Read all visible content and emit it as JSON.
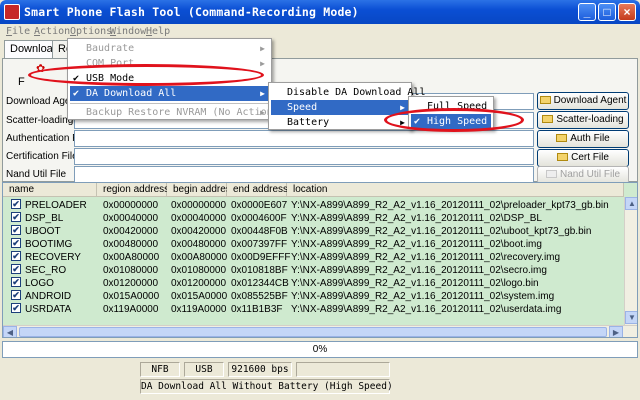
{
  "window": {
    "title": "Smart Phone Flash Tool (Command-Recording Mode)"
  },
  "window_buttons": {
    "minimize": "_",
    "maximize": "□",
    "close": "×"
  },
  "menubar": [
    {
      "key": "F",
      "rest": "ile"
    },
    {
      "key": "A",
      "rest": "ction"
    },
    {
      "key": "O",
      "rest": "ptions"
    },
    {
      "key": "W",
      "rest": "indow"
    },
    {
      "key": "H",
      "rest": "elp"
    }
  ],
  "tabs": {
    "download": "Download",
    "readback": "Re"
  },
  "toolbar": {
    "flash_label": "F"
  },
  "rows": [
    {
      "label": "Download Agent",
      "button": "Download Agent"
    },
    {
      "label": "Scatter-loading F",
      "button": "Scatter-loading"
    },
    {
      "label": "Authentication File",
      "button": "Auth File"
    },
    {
      "label": "Certification File",
      "button": "Cert File"
    },
    {
      "label": "Nand Util File",
      "button": "Nand Util File"
    }
  ],
  "table": {
    "headers": [
      "name",
      "region address",
      "begin address",
      "end address",
      "location"
    ],
    "rows": [
      {
        "checked": "✔",
        "name": "PRELOADER",
        "region": "0x00000000",
        "begin": "0x00000000",
        "end": "0x0000E607",
        "location": "Y:\\NX-A899\\A899_R2_A2_v1.16_20120111_02\\preloader_kpt73_gb.bin"
      },
      {
        "checked": "✔",
        "name": "DSP_BL",
        "region": "0x00040000",
        "begin": "0x00040000",
        "end": "0x0004600F",
        "location": "Y:\\NX-A899\\A899_R2_A2_v1.16_20120111_02\\DSP_BL"
      },
      {
        "checked": "✔",
        "name": "UBOOT",
        "region": "0x00420000",
        "begin": "0x00420000",
        "end": "0x00448F0B",
        "location": "Y:\\NX-A899\\A899_R2_A2_v1.16_20120111_02\\uboot_kpt73_gb.bin"
      },
      {
        "checked": "✔",
        "name": "BOOTIMG",
        "region": "0x00480000",
        "begin": "0x00480000",
        "end": "0x007397FF",
        "location": "Y:\\NX-A899\\A899_R2_A2_v1.16_20120111_02\\boot.img"
      },
      {
        "checked": "✔",
        "name": "RECOVERY",
        "region": "0x00A80000",
        "begin": "0x00A80000",
        "end": "0x00D9EFFF",
        "location": "Y:\\NX-A899\\A899_R2_A2_v1.16_20120111_02\\recovery.img"
      },
      {
        "checked": "✔",
        "name": "SEC_RO",
        "region": "0x01080000",
        "begin": "0x01080000",
        "end": "0x010818BF",
        "location": "Y:\\NX-A899\\A899_R2_A2_v1.16_20120111_02\\secro.img"
      },
      {
        "checked": "✔",
        "name": "LOGO",
        "region": "0x01200000",
        "begin": "0x01200000",
        "end": "0x012344CB",
        "location": "Y:\\NX-A899\\A899_R2_A2_v1.16_20120111_02\\logo.bin"
      },
      {
        "checked": "✔",
        "name": "ANDROID",
        "region": "0x015A0000",
        "begin": "0x015A0000",
        "end": "0x085525BF",
        "location": "Y:\\NX-A899\\A899_R2_A2_v1.16_20120111_02\\system.img"
      },
      {
        "checked": "✔",
        "name": "USRDATA",
        "region": "0x119A0000",
        "begin": "0x119A0000",
        "end": "0x11B1B3F",
        "location": "Y:\\NX-A899\\A899_R2_A2_v1.16_20120111_02\\userdata.img"
      }
    ]
  },
  "progress": {
    "text": "0%",
    "value": 0
  },
  "statusbar": {
    "storage": "NFB",
    "port": "USB",
    "baud": "921600 bps",
    "message": "DA Download All Without Battery (High Speed)"
  },
  "options_menu": [
    {
      "label": "Baudrate",
      "disabled": true,
      "submenu": true,
      "checked": ""
    },
    {
      "label": "COM Port",
      "disabled": true,
      "submenu": true,
      "checked": ""
    },
    {
      "label": "USB Mode",
      "disabled": false,
      "submenu": false,
      "checked": "✔"
    },
    {
      "label": "DA Download All",
      "disabled": false,
      "submenu": true,
      "checked": "✔",
      "selected": true
    },
    {
      "label": "Backup Restore NVRAM (No Action) ...",
      "disabled": true,
      "submenu": true,
      "checked": ""
    }
  ],
  "da_submenu": [
    {
      "label": "Disable DA Download All"
    },
    {
      "label": "Speed",
      "selected": true
    },
    {
      "label": "Battery"
    }
  ],
  "speed_submenu": [
    {
      "label": "Full Speed",
      "checked": ""
    },
    {
      "label": "High Speed",
      "checked": "✔",
      "selected": true
    }
  ],
  "colors": {
    "titlebar": "#0b4fd4",
    "menu_highlight": "#316ac5",
    "table_bg": "#cfeacf",
    "annotation": "#e0121c"
  }
}
